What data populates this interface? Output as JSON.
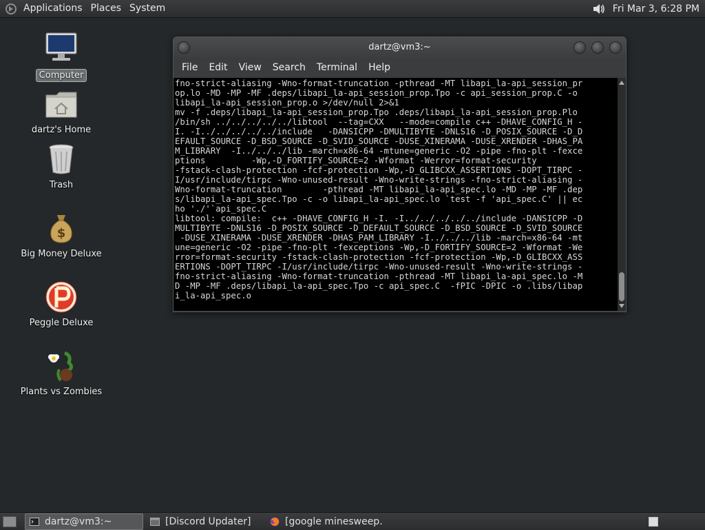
{
  "top_panel": {
    "menus": [
      "Applications",
      "Places",
      "System"
    ],
    "clock": "Fri Mar  3,  6:28 PM"
  },
  "desktop_icons": [
    {
      "label": "Computer",
      "icon": "computer-icon"
    },
    {
      "label": "dartz's Home",
      "icon": "home-folder-icon"
    },
    {
      "label": "Trash",
      "icon": "trash-icon"
    },
    {
      "label": "Big Money Deluxe",
      "icon": "money-bag-icon"
    },
    {
      "label": "Peggle Deluxe",
      "icon": "peggle-icon"
    },
    {
      "label": "Plants vs Zombies",
      "icon": "plants-vs-zombies-icon"
    }
  ],
  "terminal": {
    "title": "dartz@vm3:~",
    "menu": [
      "File",
      "Edit",
      "View",
      "Search",
      "Terminal",
      "Help"
    ],
    "output": "fno-strict-aliasing -Wno-format-truncation -pthread -MT libapi_la-api_session_pr\nop.lo -MD -MP -MF .deps/libapi_la-api_session_prop.Tpo -c api_session_prop.C -o\nlibapi_la-api_session_prop.o >/dev/null 2>&1\nmv -f .deps/libapi_la-api_session_prop.Tpo .deps/libapi_la-api_session_prop.Plo\n/bin/sh ../../../../../libtool  --tag=CXX   --mode=compile c++ -DHAVE_CONFIG_H -\nI. -I../../../../../include   -DANSICPP -DMULTIBYTE -DNLS16 -D_POSIX_SOURCE -D_D\nEFAULT_SOURCE -D_BSD_SOURCE -D_SVID_SOURCE -DUSE_XINERAMA -DUSE_XRENDER -DHAS_PA\nM_LIBRARY  -I../../../lib -march=x86-64 -mtune=generic -O2 -pipe -fno-plt -fexce\nptions         -Wp,-D_FORTIFY_SOURCE=2 -Wformat -Werror=format-security\n-fstack-clash-protection -fcf-protection -Wp,-D_GLIBCXX_ASSERTIONS -DOPT_TIRPC -\nI/usr/include/tirpc -Wno-unused-result -Wno-write-strings -fno-strict-aliasing -\nWno-format-truncation        -pthread -MT libapi_la-api_spec.lo -MD -MP -MF .dep\ns/libapi_la-api_spec.Tpo -c -o libapi_la-api_spec.lo `test -f 'api_spec.C' || ec\nho './'`api_spec.C\nlibtool: compile:  c++ -DHAVE_CONFIG_H -I. -I../../../../../include -DANSICPP -D\nMULTIBYTE -DNLS16 -D_POSIX_SOURCE -D_DEFAULT_SOURCE -D_BSD_SOURCE -D_SVID_SOURCE\n -DUSE_XINERAMA -DUSE_XRENDER -DHAS_PAM_LIBRARY -I../../../lib -march=x86-64 -mt\nune=generic -O2 -pipe -fno-plt -fexceptions -Wp,-D_FORTIFY_SOURCE=2 -Wformat -We\nrror=format-security -fstack-clash-protection -fcf-protection -Wp,-D_GLIBCXX_ASS\nERTIONS -DOPT_TIRPC -I/usr/include/tirpc -Wno-unused-result -Wno-write-strings -\nfno-strict-aliasing -Wno-format-truncation -pthread -MT libapi_la-api_spec.lo -M\nD -MP -MF .deps/libapi_la-api_spec.Tpo -c api_spec.C  -fPIC -DPIC -o .libs/libap\ni_la-api_spec.o"
  },
  "taskbar": {
    "tasks": [
      {
        "label": "dartz@vm3:~",
        "icon": "terminal-icon",
        "active": true
      },
      {
        "label": "[Discord Updater]",
        "icon": "window-icon",
        "active": false
      },
      {
        "label": "[google minesweep...",
        "icon": "firefox-icon",
        "active": false
      }
    ]
  },
  "colors": {
    "desktop_bg": "#25282a",
    "panel_bg": "#2f3133",
    "terminal_bg": "#000000",
    "terminal_fg": "#d8d8d8"
  }
}
